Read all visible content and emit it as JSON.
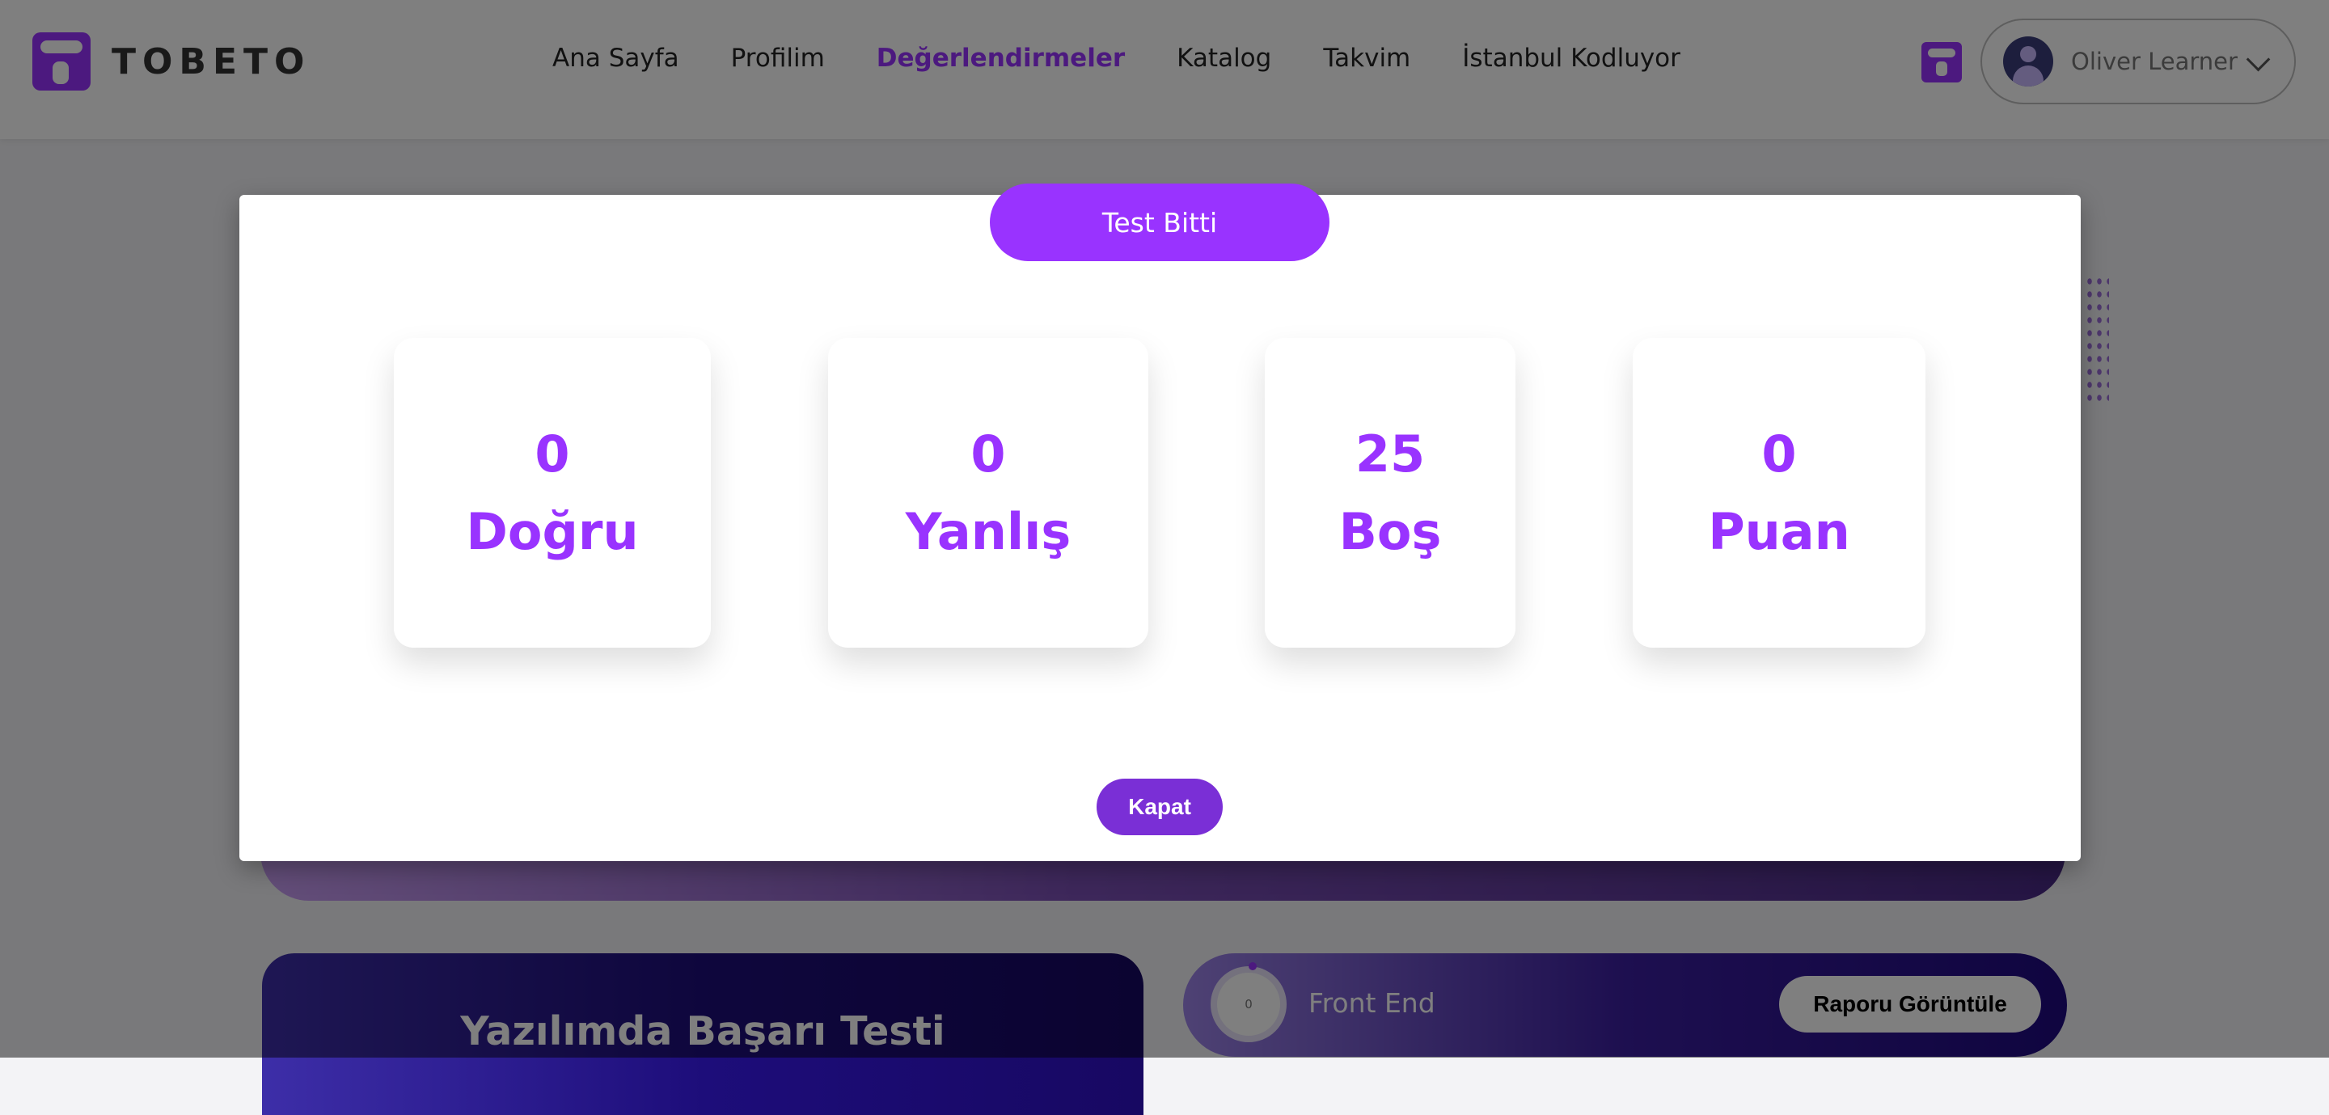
{
  "brand": {
    "name": "TOBETO"
  },
  "nav": {
    "links": [
      {
        "label": "Ana Sayfa"
      },
      {
        "label": "Profilim"
      },
      {
        "label": "Değerlendirmeler"
      },
      {
        "label": "Katalog"
      },
      {
        "label": "Takvim"
      },
      {
        "label": "İstanbul Kodluyor"
      }
    ],
    "active": "Değerlendirmeler"
  },
  "user": {
    "name": "Oliver Learner"
  },
  "modal": {
    "title": "Test Bitti",
    "stats": [
      {
        "value": "0",
        "label": "Doğru"
      },
      {
        "value": "0",
        "label": "Yanlış"
      },
      {
        "value": "25",
        "label": "Boş"
      },
      {
        "value": "0",
        "label": "Puan"
      }
    ],
    "close_label": "Kapat"
  },
  "background": {
    "test_card_title": "Yazılımda Başarı Testi",
    "result": {
      "progress_value": "0",
      "name": "Front End",
      "report_button": "Raporu Görüntüle"
    }
  },
  "colors": {
    "accent": "#9933ff",
    "close_button": "#7a2fd6",
    "overlay": "rgba(0,0,0,0.5)"
  }
}
